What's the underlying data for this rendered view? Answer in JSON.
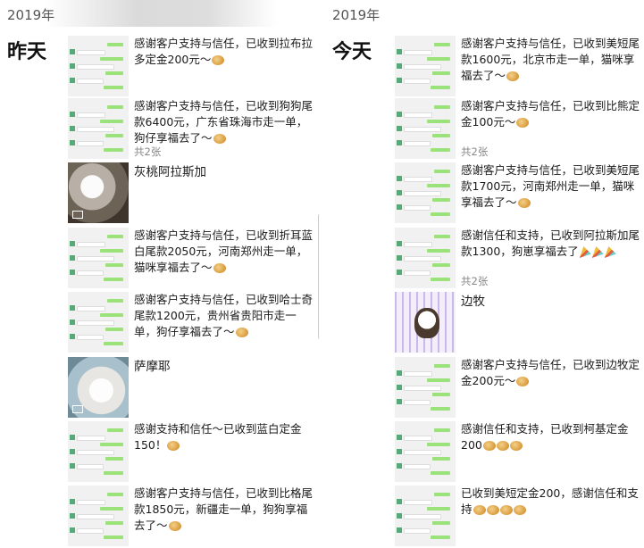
{
  "left": {
    "year": "2019年",
    "day": "昨天",
    "posts": [
      {
        "text": "感谢客户支持与信任，已收到拉布拉多定金200元～",
        "emoji": "cookie",
        "thumb": "chat",
        "count": ""
      },
      {
        "text": "感谢客户支持与信任，已收到狗狗尾款6400元，广东省珠海市走一单，狗仔享福去了～",
        "emoji": "cookie",
        "thumb": "chat",
        "count": "共2张"
      },
      {
        "text": "灰桃阿拉斯加",
        "emoji": "",
        "thumb": "photo-dog",
        "count": ""
      },
      {
        "text": "感谢客户支持与信任，已收到折耳蓝白尾款2050元，河南郑州走一单，猫咪享福去了～",
        "emoji": "cookie",
        "thumb": "chat",
        "count": ""
      },
      {
        "text": "感谢客户支持与信任，已收到哈士奇尾款1200元，贵州省贵阳市走一单，狗仔享福去了～",
        "emoji": "cookie",
        "thumb": "chat",
        "count": ""
      },
      {
        "text": "萨摩耶",
        "emoji": "",
        "thumb": "photo-white",
        "count": ""
      },
      {
        "text": "感谢支持和信任～已收到蓝白定金150！",
        "emoji": "cookie",
        "thumb": "chat",
        "count": ""
      },
      {
        "text": "感谢客户支持与信任，已收到比格尾款1850元，新疆走一单，狗狗享福去了～",
        "emoji": "cookie",
        "thumb": "chat",
        "count": ""
      }
    ]
  },
  "right": {
    "year": "2019年",
    "day": "今天",
    "posts": [
      {
        "text": "感谢客户支持与信任，已收到美短尾款1600元，北京市走一单，猫咪享福去了～",
        "emoji": "cookie",
        "thumb": "chat",
        "count": ""
      },
      {
        "text": "感谢客户支持与信任，已收到比熊定金100元～",
        "emoji": "cookie",
        "thumb": "chat",
        "count": "共2张"
      },
      {
        "text": "感谢客户支持与信任，已收到美短尾款1700元，河南郑州走一单，猫咪享福去了～",
        "emoji": "cookie",
        "thumb": "chat",
        "count": ""
      },
      {
        "text": "感谢信任和支持，已收到阿拉斯加尾款1300，狗崽享福去了",
        "emoji": "party",
        "thumb": "chat",
        "count": "共2张"
      },
      {
        "text": "边牧",
        "emoji": "",
        "thumb": "photo-cage",
        "count": ""
      },
      {
        "text": "感谢客户支持与信任，已收到边牧定金200元～",
        "emoji": "cookie",
        "thumb": "chat",
        "count": ""
      },
      {
        "text": "感谢信任和支持，已收到柯基定金200",
        "emoji": "cookie3",
        "thumb": "chat",
        "count": ""
      },
      {
        "text": "已收到美短定金200，感谢信任和支持",
        "emoji": "cookie4",
        "thumb": "chat",
        "count": ""
      }
    ]
  }
}
